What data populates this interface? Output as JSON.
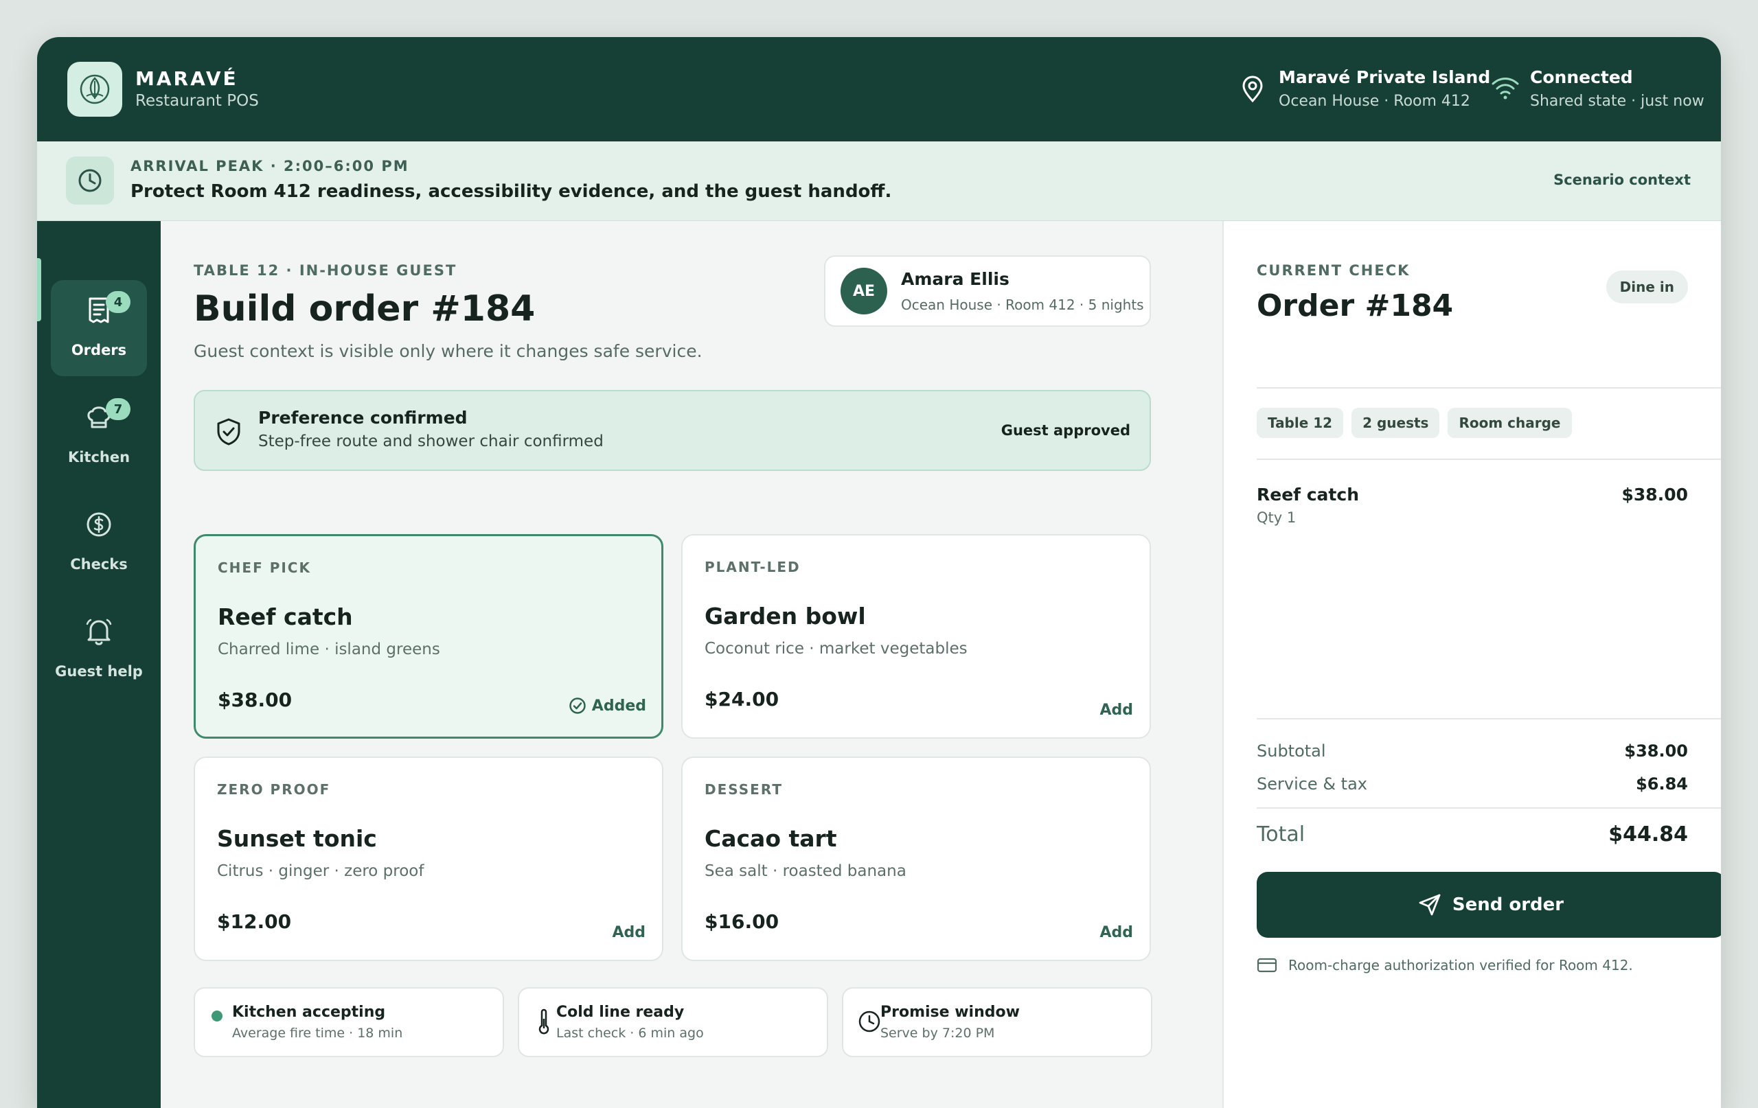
{
  "brand": {
    "name": "MARAVÉ",
    "subtitle": "Restaurant POS"
  },
  "header": {
    "location": {
      "title": "Maravé Private Island",
      "subtitle": "Ocean House · Room 412",
      "icon": "map-pin-icon"
    },
    "connection": {
      "title": "Connected",
      "subtitle": "Shared state · just now",
      "icon": "wifi-icon"
    }
  },
  "scenario": {
    "eyebrow": "ARRIVAL PEAK · 2:00–6:00 PM",
    "text": "Protect Room 412 readiness, accessibility evidence, and the guest handoff.",
    "link": "Scenario context"
  },
  "sidebar": {
    "items": [
      {
        "label": "Orders",
        "icon": "receipt-icon",
        "badge": "4",
        "active": true
      },
      {
        "label": "Kitchen",
        "icon": "chef-hat-icon",
        "badge": "7",
        "active": false
      },
      {
        "label": "Checks",
        "icon": "dollar-icon",
        "badge": "",
        "active": false
      },
      {
        "label": "Guest help",
        "icon": "bell-icon",
        "badge": "",
        "active": false
      }
    ]
  },
  "main": {
    "eyebrow": "TABLE 12 · IN-HOUSE GUEST",
    "title": "Build order #184",
    "subtitle": "Guest context is visible only where it changes safe service.",
    "guest": {
      "initials": "AE",
      "name": "Amara Ellis",
      "detail": "Ocean House · Room 412 · 5 nights"
    },
    "preference": {
      "title": "Preference confirmed",
      "detail": "Step-free route and shower chair confirmed",
      "status": "Guest approved"
    },
    "menu": [
      {
        "category": "CHEF PICK",
        "name": "Reef catch",
        "desc": "Charred lime · island greens",
        "price": "$38.00",
        "action": "Added",
        "selected": true
      },
      {
        "category": "PLANT-LED",
        "name": "Garden bowl",
        "desc": "Coconut rice · market vegetables",
        "price": "$24.00",
        "action": "Add",
        "selected": false
      },
      {
        "category": "ZERO PROOF",
        "name": "Sunset tonic",
        "desc": "Citrus · ginger · zero proof",
        "price": "$12.00",
        "action": "Add",
        "selected": false
      },
      {
        "category": "DESSERT",
        "name": "Cacao tart",
        "desc": "Sea salt · roasted banana",
        "price": "$16.00",
        "action": "Add",
        "selected": false
      }
    ],
    "status": [
      {
        "title": "Kitchen accepting",
        "detail": "Average fire time · 18 min",
        "icon": "status-dot-icon"
      },
      {
        "title": "Cold line ready",
        "detail": "Last check · 6 min ago",
        "icon": "thermometer-icon"
      },
      {
        "title": "Promise window",
        "detail": "Serve by 7:20 PM",
        "icon": "clock-icon"
      }
    ]
  },
  "check": {
    "eyebrow": "CURRENT CHECK",
    "title": "Order #184",
    "mode": "Dine in",
    "chips": [
      "Table 12",
      "2 guests",
      "Room charge"
    ],
    "lines": [
      {
        "name": "Reef catch",
        "qty": "Qty 1",
        "price": "$38.00"
      }
    ],
    "subtotal_label": "Subtotal",
    "subtotal": "$38.00",
    "service_label": "Service & tax",
    "service": "$6.84",
    "total_label": "Total",
    "total": "$44.84",
    "send_label": "Send order",
    "auth_note": "Room-charge authorization verified for Room 412."
  },
  "colors": {
    "primary": "#163f35",
    "accent": "#9bdcbf",
    "selected_border": "#3f8a6d",
    "panel": "#dceee6"
  }
}
